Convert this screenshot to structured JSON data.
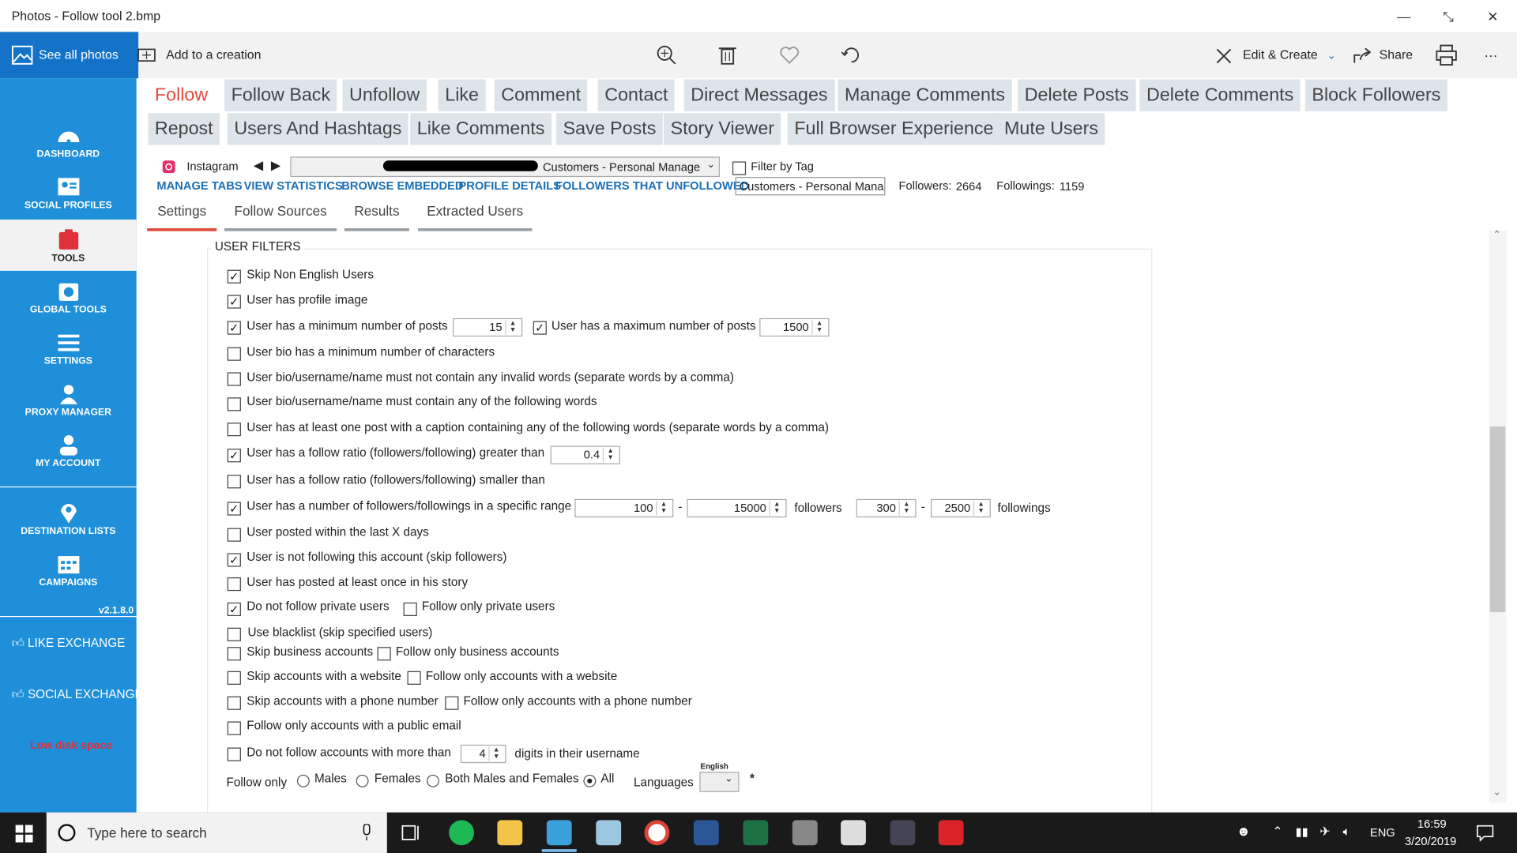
{
  "window": {
    "title": "Photos - Follow tool 2.bmp",
    "minimize": "—",
    "restore": "⤡",
    "close": "✕"
  },
  "toolbar": {
    "see_all": "See all photos",
    "add_creation": "Add to a creation",
    "edit_create": "Edit & Create",
    "share": "Share",
    "more": "···"
  },
  "sidebar": {
    "items": [
      {
        "label": "DASHBOARD",
        "icon": "dashboard-icon"
      },
      {
        "label": "SOCIAL PROFILES",
        "icon": "social-profiles-icon"
      },
      {
        "label": "TOOLS",
        "icon": "tools-icon"
      },
      {
        "label": "GLOBAL TOOLS",
        "icon": "global-tools-icon"
      },
      {
        "label": "SETTINGS",
        "icon": "settings-sliders-icon"
      },
      {
        "label": "PROXY MANAGER",
        "icon": "proxy-manager-icon"
      },
      {
        "label": "MY ACCOUNT",
        "icon": "user-icon"
      },
      {
        "label": "DESTINATION LISTS",
        "icon": "location-pin-icon"
      },
      {
        "label": "CAMPAIGNS",
        "icon": "calendar-icon"
      }
    ],
    "version": "v2.1.8.0",
    "like_exchange": "LIKE EXCHANGE",
    "social_exchange": "SOCIAL EXCHANGE",
    "low_disk": "Low disk space"
  },
  "tabs_row1": [
    "Follow",
    "Follow Back",
    "Unfollow",
    "Like",
    "Comment",
    "Contact",
    "Direct Messages",
    "Manage Comments",
    "Delete Posts",
    "Delete Comments",
    "Block Followers"
  ],
  "tabs_row2": [
    "Repost",
    "Users And Hashtags",
    "Like Comments",
    "Save Posts",
    "Story Viewer",
    "Full Browser Experience",
    "Mute Users"
  ],
  "account": {
    "platform": "Instagram",
    "selected": "Customers - Personal Manage",
    "filter_by_tag": "Filter by Tag",
    "group_field": "Customers - Personal Mana",
    "followers_label": "Followers:",
    "followers": "2664",
    "followings_label": "Followings:",
    "followings": "1159"
  },
  "links": [
    "MANAGE TABS",
    "VIEW STATISTICS",
    "BROWSE EMBEDDED",
    "PROFILE DETAILS",
    "FOLLOWERS THAT UNFOLLOWED"
  ],
  "subtabs": [
    "Settings",
    "Follow Sources",
    "Results",
    "Extracted Users"
  ],
  "filters": {
    "legend": "USER FILTERS",
    "skip_non_english": "Skip Non English Users",
    "profile_image": "User has profile image",
    "min_posts": "User has a minimum number of posts",
    "min_posts_val": "15",
    "max_posts": "User has a maximum number of posts",
    "max_posts_val": "1500",
    "bio_min_chars": "User bio has a minimum number of characters",
    "bio_invalid": "User bio/username/name must not contain any invalid words (separate words by a comma)",
    "bio_contains": "User bio/username/name must contain any of the following words",
    "caption_contains": "User has at least one post with a caption containing any of the following words (separate words by a comma)",
    "ratio_greater": "User has a follow ratio (followers/following) greater than",
    "ratio_greater_val": "0.4",
    "ratio_smaller": "User has a follow ratio (followers/following) smaller than",
    "range": "User has a number of followers/followings in a specific range",
    "followers_min": "100",
    "followers_max": "15000",
    "followers_word": "followers",
    "followings_min": "300",
    "followings_max": "2500",
    "followings_word": "followings",
    "dash": "-",
    "posted_within": "User posted within the last X days",
    "not_following": "User is not following this account (skip followers)",
    "story": "User has posted at least once in his story",
    "no_private": "Do not follow private users",
    "only_private": "Follow only private users",
    "blacklist": "Use blacklist (skip specified users)",
    "skip_business": "Skip business accounts",
    "only_business": "Follow only business accounts",
    "skip_website": "Skip accounts with a website",
    "only_website": "Follow only accounts with a website",
    "skip_phone": "Skip accounts with a phone number",
    "only_phone": "Follow only accounts with a phone number",
    "public_email": "Follow only accounts with a public email",
    "digits": "Do not follow accounts with more than",
    "digits_val": "4",
    "digits_tail": "digits in their username",
    "follow_only": "Follow only",
    "males": "Males",
    "females": "Females",
    "both": "Both Males and Females",
    "all": "All",
    "languages": "Languages",
    "lang_tag": "English",
    "asterisk": "*"
  },
  "taskbar": {
    "search_placeholder": "Type here to search",
    "lang": "ENG",
    "time": "16:59",
    "date": "3/20/2019"
  }
}
